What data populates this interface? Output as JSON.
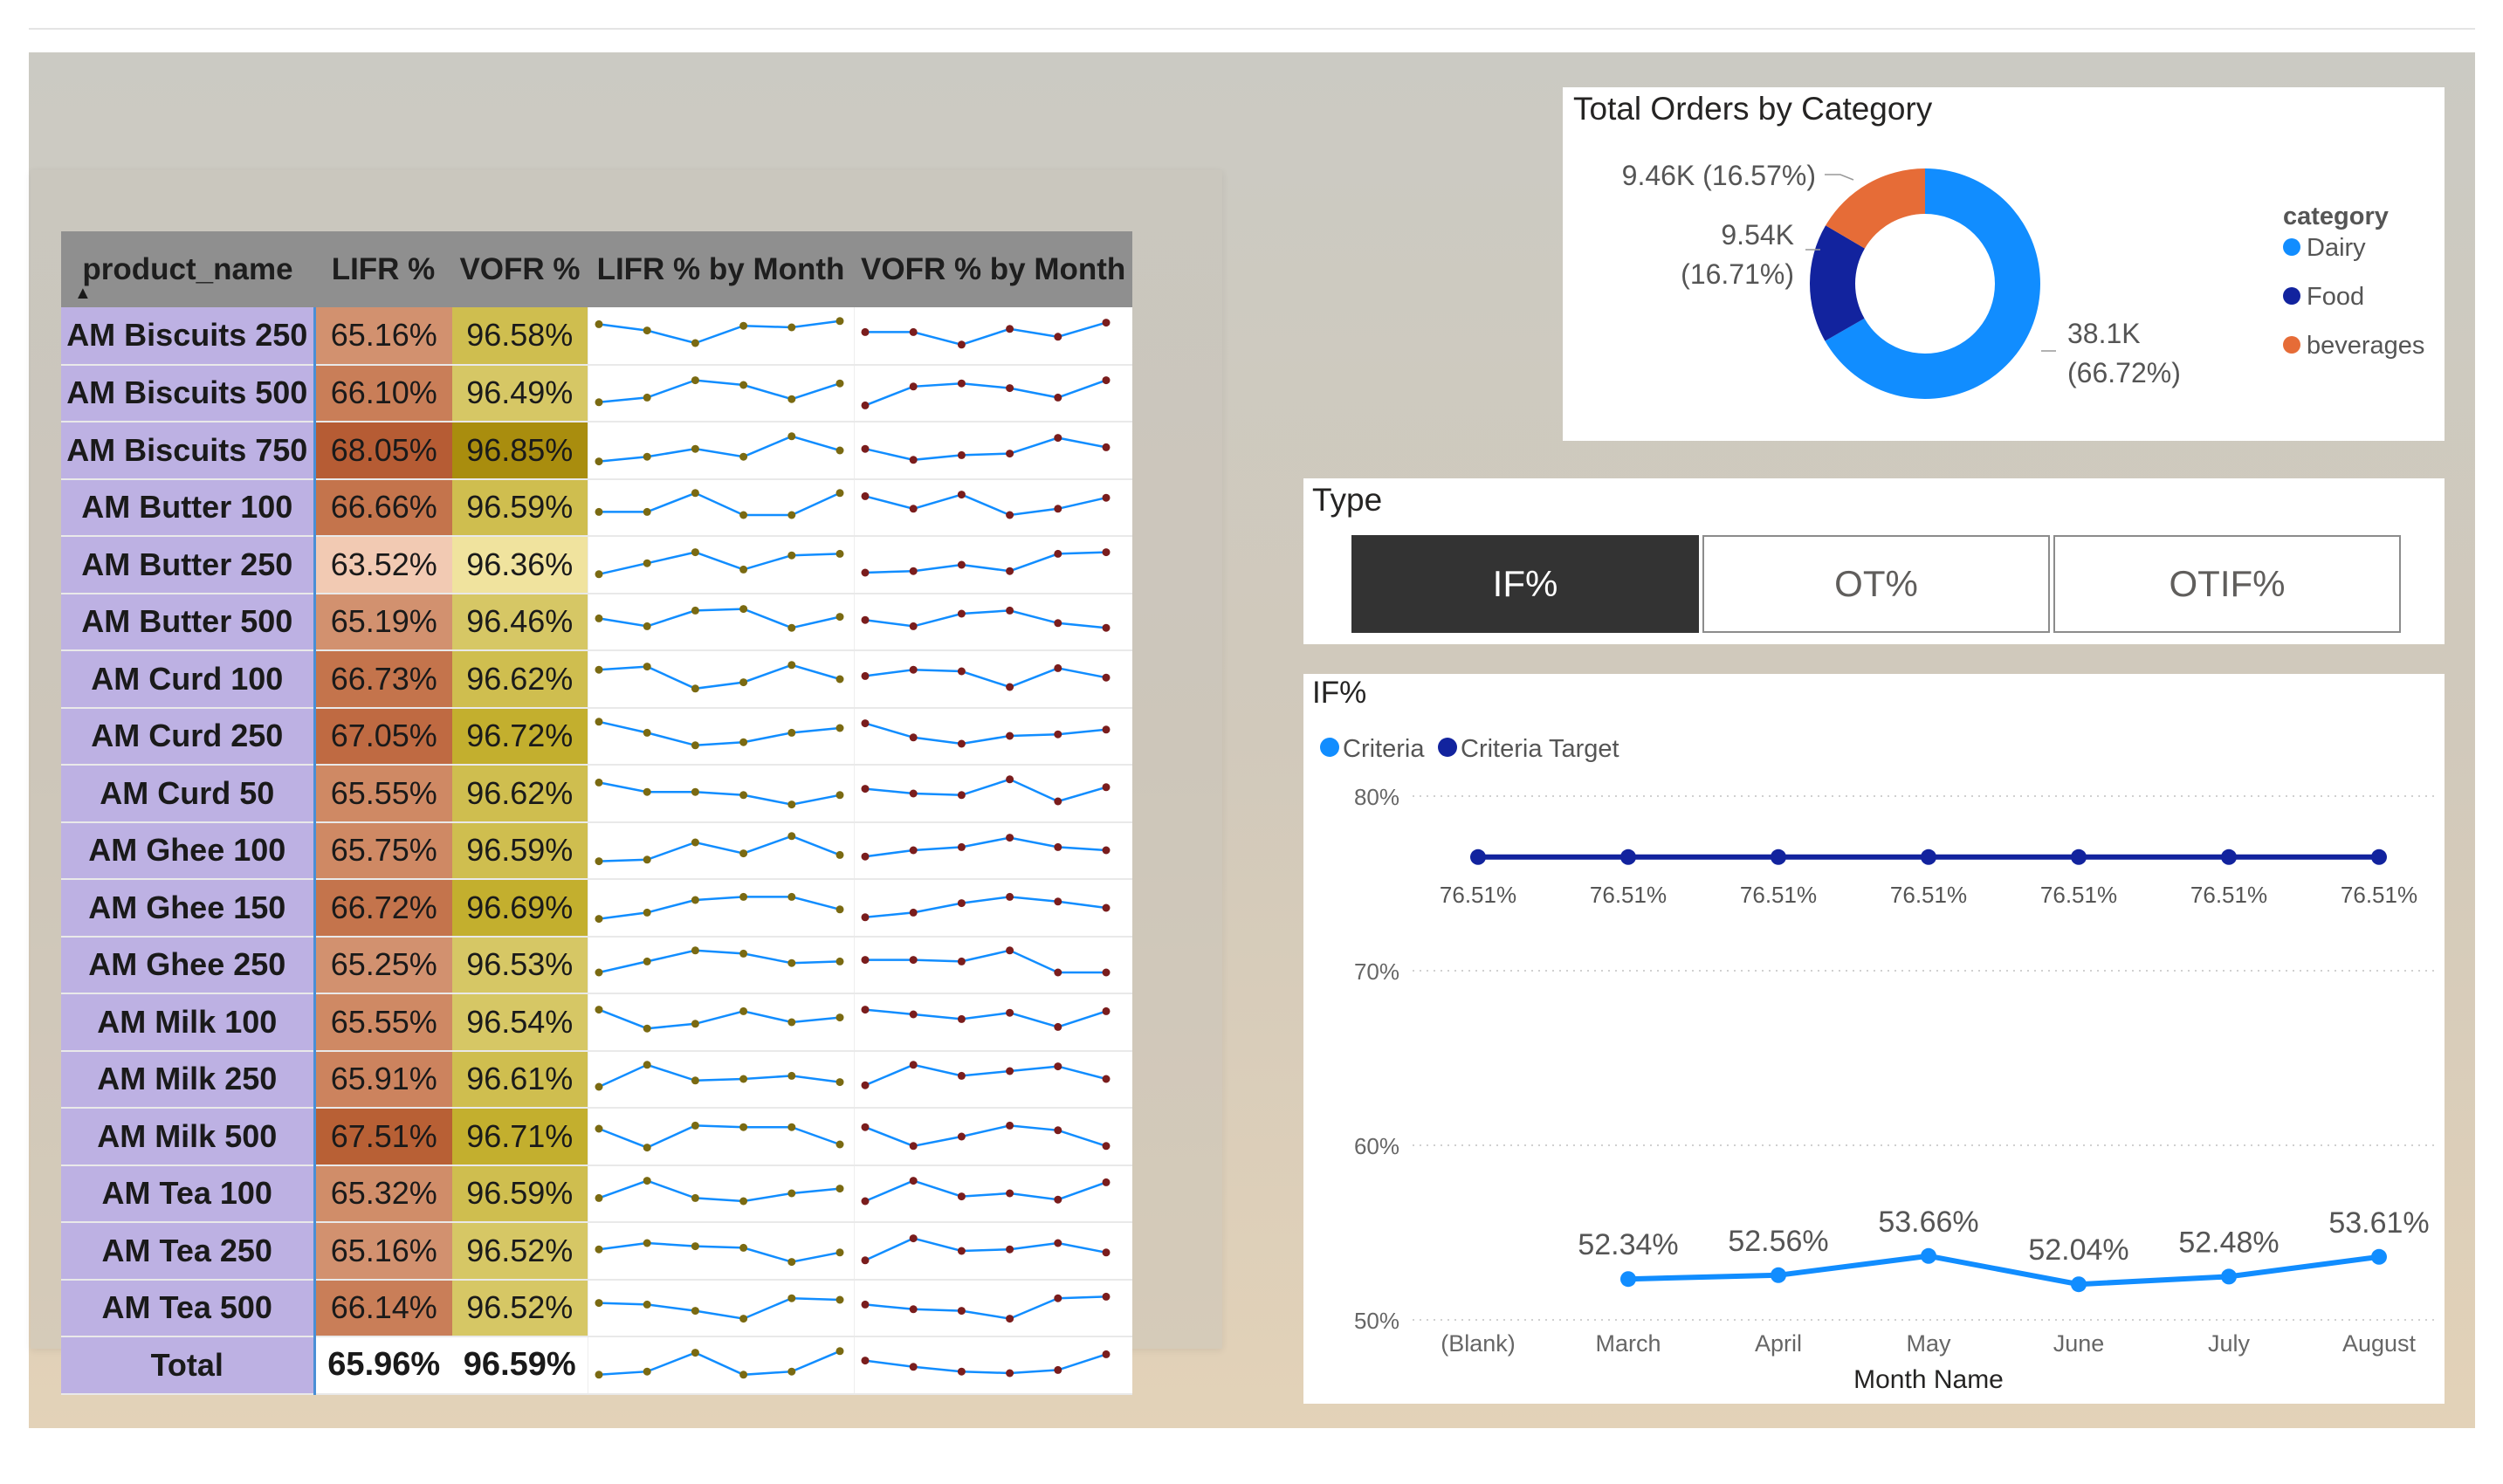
{
  "matrix": {
    "headers": [
      "product_name",
      "LIFR %",
      "VOFR %",
      "LIFR % by Month",
      "VOFR % by Month"
    ],
    "rows": [
      {
        "name": "AM Biscuits 250",
        "lifr": "65.16%",
        "vofr": "96.58%",
        "lifr_color": "#d2916f",
        "vofr_color": "#cfbe4f",
        "sl": [
          0.85,
          0.65,
          0.25,
          0.8,
          0.75,
          0.95
        ],
        "sv": [
          0.6,
          0.6,
          0.2,
          0.7,
          0.45,
          0.9
        ]
      },
      {
        "name": "AM Biscuits 500",
        "lifr": "66.10%",
        "vofr": "96.49%",
        "lifr_color": "#c97e58",
        "vofr_color": "#d6c765",
        "sl": [
          0.2,
          0.35,
          0.9,
          0.75,
          0.3,
          0.8
        ],
        "sv": [
          0.1,
          0.7,
          0.8,
          0.65,
          0.35,
          0.9
        ]
      },
      {
        "name": "AM Biscuits 750",
        "lifr": "68.05%",
        "vofr": "96.85%",
        "lifr_color": "#b65c34",
        "vofr_color": "#a98d0e",
        "sl": [
          0.15,
          0.3,
          0.55,
          0.3,
          0.95,
          0.5
        ],
        "sv": [
          0.55,
          0.2,
          0.35,
          0.4,
          0.9,
          0.6
        ]
      },
      {
        "name": "AM Butter 100",
        "lifr": "66.66%",
        "vofr": "96.59%",
        "lifr_color": "#c4744c",
        "vofr_color": "#cfbe4f",
        "sl": [
          0.35,
          0.35,
          0.95,
          0.25,
          0.25,
          0.95
        ],
        "sv": [
          0.85,
          0.45,
          0.9,
          0.25,
          0.45,
          0.8
        ]
      },
      {
        "name": "AM Butter 250",
        "lifr": "63.52%",
        "vofr": "96.36%",
        "lifr_color": "#f2cab3",
        "vofr_color": "#f0e39e",
        "sl": [
          0.2,
          0.55,
          0.9,
          0.35,
          0.8,
          0.85
        ],
        "sv": [
          0.25,
          0.3,
          0.5,
          0.3,
          0.85,
          0.9
        ]
      },
      {
        "name": "AM Butter 500",
        "lifr": "65.19%",
        "vofr": "96.46%",
        "lifr_color": "#d2916f",
        "vofr_color": "#d6c765",
        "sl": [
          0.6,
          0.35,
          0.85,
          0.9,
          0.3,
          0.65
        ],
        "sv": [
          0.55,
          0.35,
          0.75,
          0.85,
          0.45,
          0.3
        ]
      },
      {
        "name": "AM Curd 100",
        "lifr": "66.73%",
        "vofr": "96.62%",
        "lifr_color": "#c4744c",
        "vofr_color": "#cfbe4f",
        "sl": [
          0.8,
          0.9,
          0.2,
          0.4,
          0.95,
          0.5
        ],
        "sv": [
          0.6,
          0.8,
          0.75,
          0.25,
          0.85,
          0.55
        ]
      },
      {
        "name": "AM Curd 250",
        "lifr": "67.05%",
        "vofr": "96.72%",
        "lifr_color": "#bf6a42",
        "vofr_color": "#c3af2e",
        "sl": [
          0.95,
          0.6,
          0.2,
          0.3,
          0.6,
          0.75
        ],
        "sv": [
          0.9,
          0.45,
          0.25,
          0.5,
          0.55,
          0.7
        ]
      },
      {
        "name": "AM Curd 50",
        "lifr": "65.55%",
        "vofr": "96.62%",
        "lifr_color": "#cf8964",
        "vofr_color": "#cfbe4f",
        "sl": [
          0.85,
          0.55,
          0.55,
          0.45,
          0.15,
          0.45
        ],
        "sv": [
          0.65,
          0.5,
          0.45,
          0.95,
          0.25,
          0.7
        ]
      },
      {
        "name": "AM Ghee 100",
        "lifr": "65.75%",
        "vofr": "96.59%",
        "lifr_color": "#cf8964",
        "vofr_color": "#cfbe4f",
        "sl": [
          0.15,
          0.2,
          0.75,
          0.4,
          0.95,
          0.35
        ],
        "sv": [
          0.3,
          0.5,
          0.6,
          0.9,
          0.6,
          0.5
        ]
      },
      {
        "name": "AM Ghee 150",
        "lifr": "66.72%",
        "vofr": "96.69%",
        "lifr_color": "#c4744c",
        "vofr_color": "#c3af2e",
        "sl": [
          0.15,
          0.35,
          0.75,
          0.85,
          0.85,
          0.45
        ],
        "sv": [
          0.2,
          0.35,
          0.65,
          0.85,
          0.7,
          0.5
        ]
      },
      {
        "name": "AM Ghee 250",
        "lifr": "65.25%",
        "vofr": "96.53%",
        "lifr_color": "#d2916f",
        "vofr_color": "#d6c765",
        "sl": [
          0.25,
          0.6,
          0.95,
          0.85,
          0.55,
          0.6
        ],
        "sv": [
          0.65,
          0.65,
          0.6,
          0.95,
          0.25,
          0.25
        ]
      },
      {
        "name": "AM Milk 100",
        "lifr": "65.55%",
        "vofr": "96.54%",
        "lifr_color": "#cf8964",
        "vofr_color": "#d6c765",
        "sl": [
          0.9,
          0.3,
          0.45,
          0.85,
          0.5,
          0.65
        ],
        "sv": [
          0.9,
          0.75,
          0.6,
          0.8,
          0.35,
          0.85
        ]
      },
      {
        "name": "AM Milk 250",
        "lifr": "65.91%",
        "vofr": "96.61%",
        "lifr_color": "#cc835e",
        "vofr_color": "#cfbe4f",
        "sl": [
          0.25,
          0.95,
          0.45,
          0.5,
          0.6,
          0.4
        ],
        "sv": [
          0.3,
          0.95,
          0.6,
          0.75,
          0.9,
          0.5
        ]
      },
      {
        "name": "AM Milk 500",
        "lifr": "67.51%",
        "vofr": "96.71%",
        "lifr_color": "#b86035",
        "vofr_color": "#c3af2e",
        "sl": [
          0.75,
          0.15,
          0.85,
          0.8,
          0.8,
          0.25
        ],
        "sv": [
          0.8,
          0.2,
          0.5,
          0.85,
          0.7,
          0.2
        ]
      },
      {
        "name": "AM Tea 100",
        "lifr": "65.32%",
        "vofr": "96.59%",
        "lifr_color": "#d08d69",
        "vofr_color": "#cfbe4f",
        "sl": [
          0.35,
          0.9,
          0.35,
          0.25,
          0.5,
          0.65
        ],
        "sv": [
          0.25,
          0.9,
          0.4,
          0.5,
          0.3,
          0.85
        ]
      },
      {
        "name": "AM Tea 250",
        "lifr": "65.16%",
        "vofr": "96.52%",
        "lifr_color": "#d2916f",
        "vofr_color": "#d6c765",
        "sl": [
          0.55,
          0.75,
          0.65,
          0.6,
          0.15,
          0.45
        ],
        "sv": [
          0.2,
          0.9,
          0.5,
          0.55,
          0.75,
          0.45
        ]
      },
      {
        "name": "AM Tea 500",
        "lifr": "66.14%",
        "vofr": "96.52%",
        "lifr_color": "#c97e58",
        "vofr_color": "#d6c765",
        "sl": [
          0.65,
          0.6,
          0.4,
          0.15,
          0.8,
          0.75
        ],
        "sv": [
          0.6,
          0.45,
          0.4,
          0.15,
          0.8,
          0.85
        ]
      }
    ],
    "total": {
      "name": "Total",
      "lifr": "65.96%",
      "vofr": "96.59%",
      "sl": [
        0.2,
        0.3,
        0.9,
        0.2,
        0.3,
        0.95
      ],
      "sv": [
        0.65,
        0.45,
        0.3,
        0.25,
        0.35,
        0.85
      ]
    }
  },
  "donut": {
    "title": "Total Orders by Category",
    "legend_title": "category",
    "slices": [
      {
        "name": "Dairy",
        "value": 38.1,
        "label_value": "38.1K",
        "label_pct": "(66.72%)",
        "color": "#118dff"
      },
      {
        "name": "Food",
        "value": 9.54,
        "label_value": "9.54K",
        "label_pct": "(16.71%)",
        "color": "#12239e"
      },
      {
        "name": "beverages",
        "value": 9.46,
        "label_value": "9.46K (16.57%)",
        "label_pct": "",
        "color": "#e66c37"
      }
    ]
  },
  "slicer": {
    "title": "Type",
    "options": [
      "IF%",
      "OT%",
      "OTIF%"
    ],
    "selected": "IF%"
  },
  "line_chart": {
    "title": "IF%",
    "legend": [
      {
        "name": "Criteria",
        "color": "#118dff"
      },
      {
        "name": "Criteria Target",
        "color": "#12239e"
      }
    ],
    "xlabel": "Month Name"
  },
  "chart_data": {
    "type": "line",
    "title": "IF%",
    "xlabel": "Month Name",
    "ylabel": "",
    "categories": [
      "(Blank)",
      "March",
      "April",
      "May",
      "June",
      "July",
      "August"
    ],
    "ylim": [
      50,
      80
    ],
    "yticks": [
      "50%",
      "60%",
      "70%",
      "80%"
    ],
    "grid": true,
    "legend_position": "top-left",
    "series": [
      {
        "name": "Criteria",
        "values": [
          null,
          52.34,
          52.56,
          53.66,
          52.04,
          52.48,
          53.61
        ],
        "labels": [
          "",
          "52.34%",
          "52.56%",
          "53.66%",
          "52.04%",
          "52.48%",
          "53.61%"
        ],
        "color": "#118dff"
      },
      {
        "name": "Criteria Target",
        "values": [
          76.51,
          76.51,
          76.51,
          76.51,
          76.51,
          76.51,
          76.51
        ],
        "labels": [
          "76.51%",
          "76.51%",
          "76.51%",
          "76.51%",
          "76.51%",
          "76.51%",
          "76.51%"
        ],
        "color": "#12239e"
      }
    ]
  }
}
